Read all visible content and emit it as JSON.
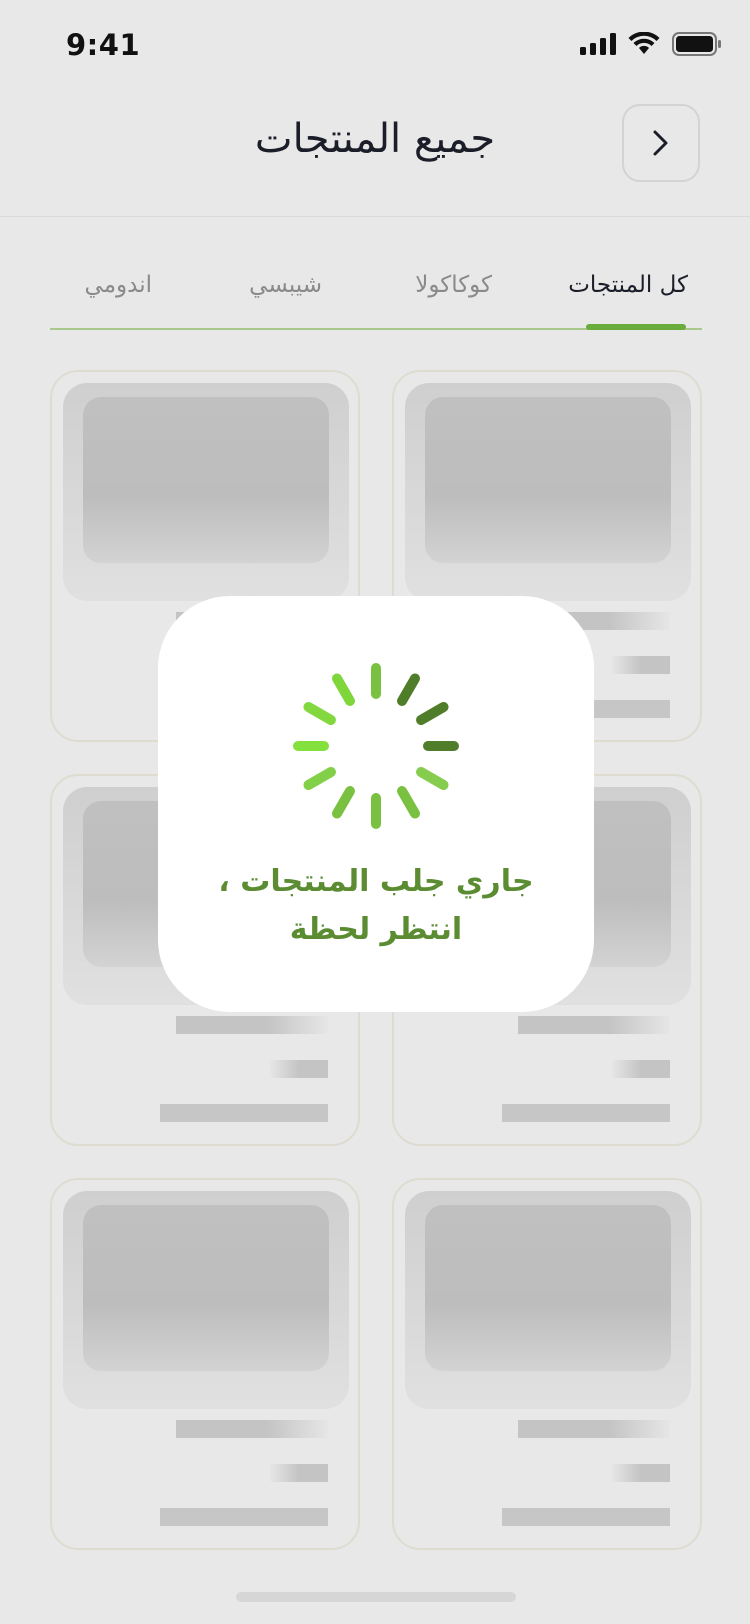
{
  "status_bar": {
    "time": "9:41"
  },
  "header": {
    "title": "جميع المنتجات"
  },
  "tabs": [
    {
      "label": "كل المنتجات",
      "active": true
    },
    {
      "label": "كوكاكولا",
      "active": false
    },
    {
      "label": "شيبسي",
      "active": false
    },
    {
      "label": "اندومي",
      "active": false
    }
  ],
  "loading": {
    "line1": "جاري جلب المنتجات ،",
    "line2": "انتظر لحظة"
  },
  "colors": {
    "accent": "#6aac3c",
    "loading_text": "#5b8c32",
    "spinner_light": "#7fe03a",
    "spinner_dark": "#4f7d2a"
  }
}
